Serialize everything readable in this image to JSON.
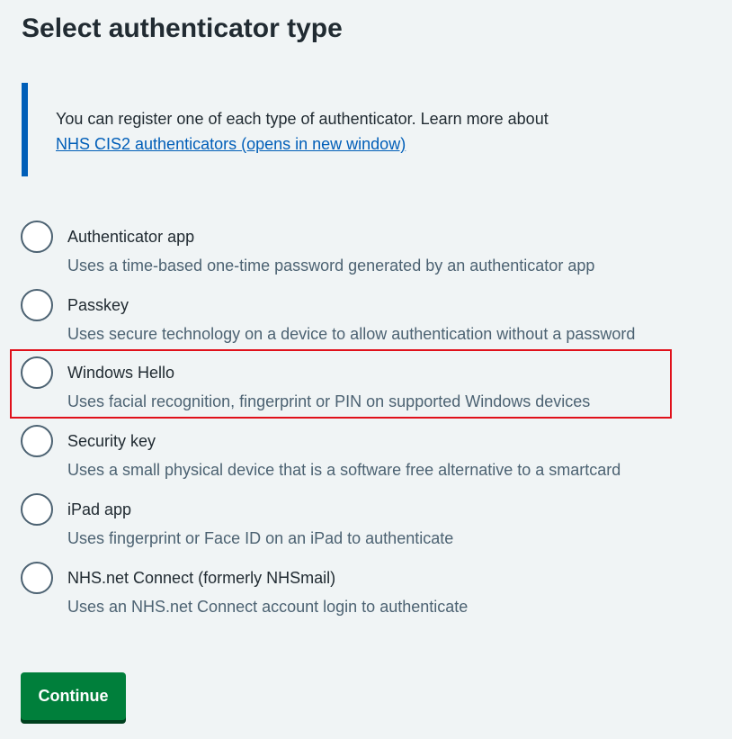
{
  "page": {
    "title": "Select authenticator type"
  },
  "inset": {
    "text": "You can register one of each type of authenticator. Learn more about",
    "link_text": "NHS CIS2 authenticators (opens in new window)"
  },
  "options": [
    {
      "label": "Authenticator app",
      "hint": "Uses a time-based one-time password generated by an authenticator app",
      "selected": false
    },
    {
      "label": "Passkey",
      "hint": "Uses secure technology on a device to allow authentication without a password",
      "selected": false
    },
    {
      "label": "Windows Hello",
      "hint": "Uses facial recognition, fingerprint or PIN on supported Windows devices",
      "selected": false,
      "highlighted": true
    },
    {
      "label": "Security key",
      "hint": "Uses a small physical device that is a software free alternative to a smartcard",
      "selected": false
    },
    {
      "label": "iPad app",
      "hint": "Uses fingerprint or Face ID on an iPad to authenticate",
      "selected": false
    },
    {
      "label": "NHS.net Connect (formerly NHSmail)",
      "hint": "Uses an NHS.net Connect account login to authenticate",
      "selected": false
    }
  ],
  "actions": {
    "continue_label": "Continue"
  },
  "colors": {
    "background": "#f0f4f5",
    "text": "#212b32",
    "hint": "#4c6272",
    "link": "#005eb8",
    "inset_border": "#005eb8",
    "button": "#007f3b",
    "button_shadow": "#00401e",
    "highlight": "#e0101a"
  }
}
